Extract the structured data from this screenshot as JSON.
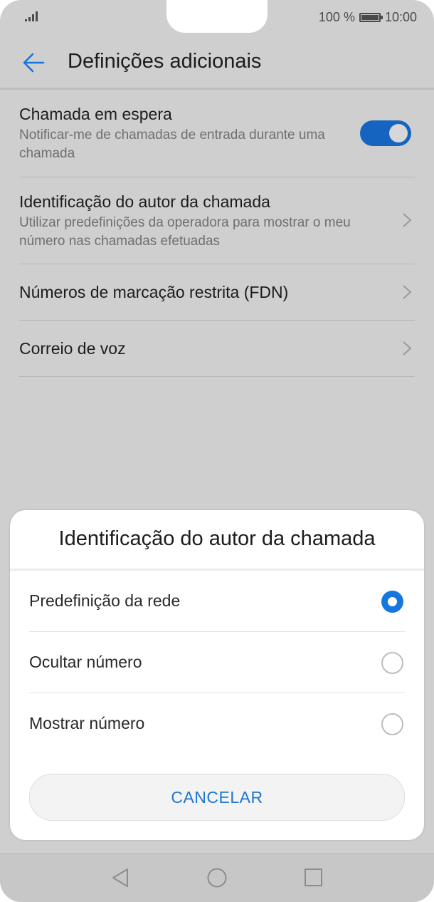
{
  "status": {
    "battery_text": "100 %",
    "time": "10:00"
  },
  "header": {
    "title": "Definições adicionais"
  },
  "settings": [
    {
      "title": "Chamada em espera",
      "subtitle": "Notificar-me de chamadas de entrada durante uma chamada",
      "control": "toggle",
      "toggle_on": true
    },
    {
      "title": "Identificação do autor da chamada",
      "subtitle": "Utilizar predefinições da operadora para mostrar o meu número nas chamadas efetuadas",
      "control": "chevron-right-icon"
    },
    {
      "title": "Números de marcação restrita (FDN)",
      "control": "chevron-right-icon"
    },
    {
      "title": "Correio de voz",
      "control": "chevron-right-icon"
    }
  ],
  "dialog": {
    "title": "Identificação do autor da chamada",
    "options": [
      {
        "label": "Predefinição da rede",
        "selected": true
      },
      {
        "label": "Ocultar número",
        "selected": false
      },
      {
        "label": "Mostrar número",
        "selected": false
      }
    ],
    "cancel_label": "CANCELAR"
  },
  "navbar": {
    "icons": [
      "back-triangle-icon",
      "home-circle-icon",
      "recents-square-icon"
    ]
  },
  "colors": {
    "accent": "#1676e0",
    "toggle": "#1565c0",
    "cancel_text": "#1e76d4"
  }
}
